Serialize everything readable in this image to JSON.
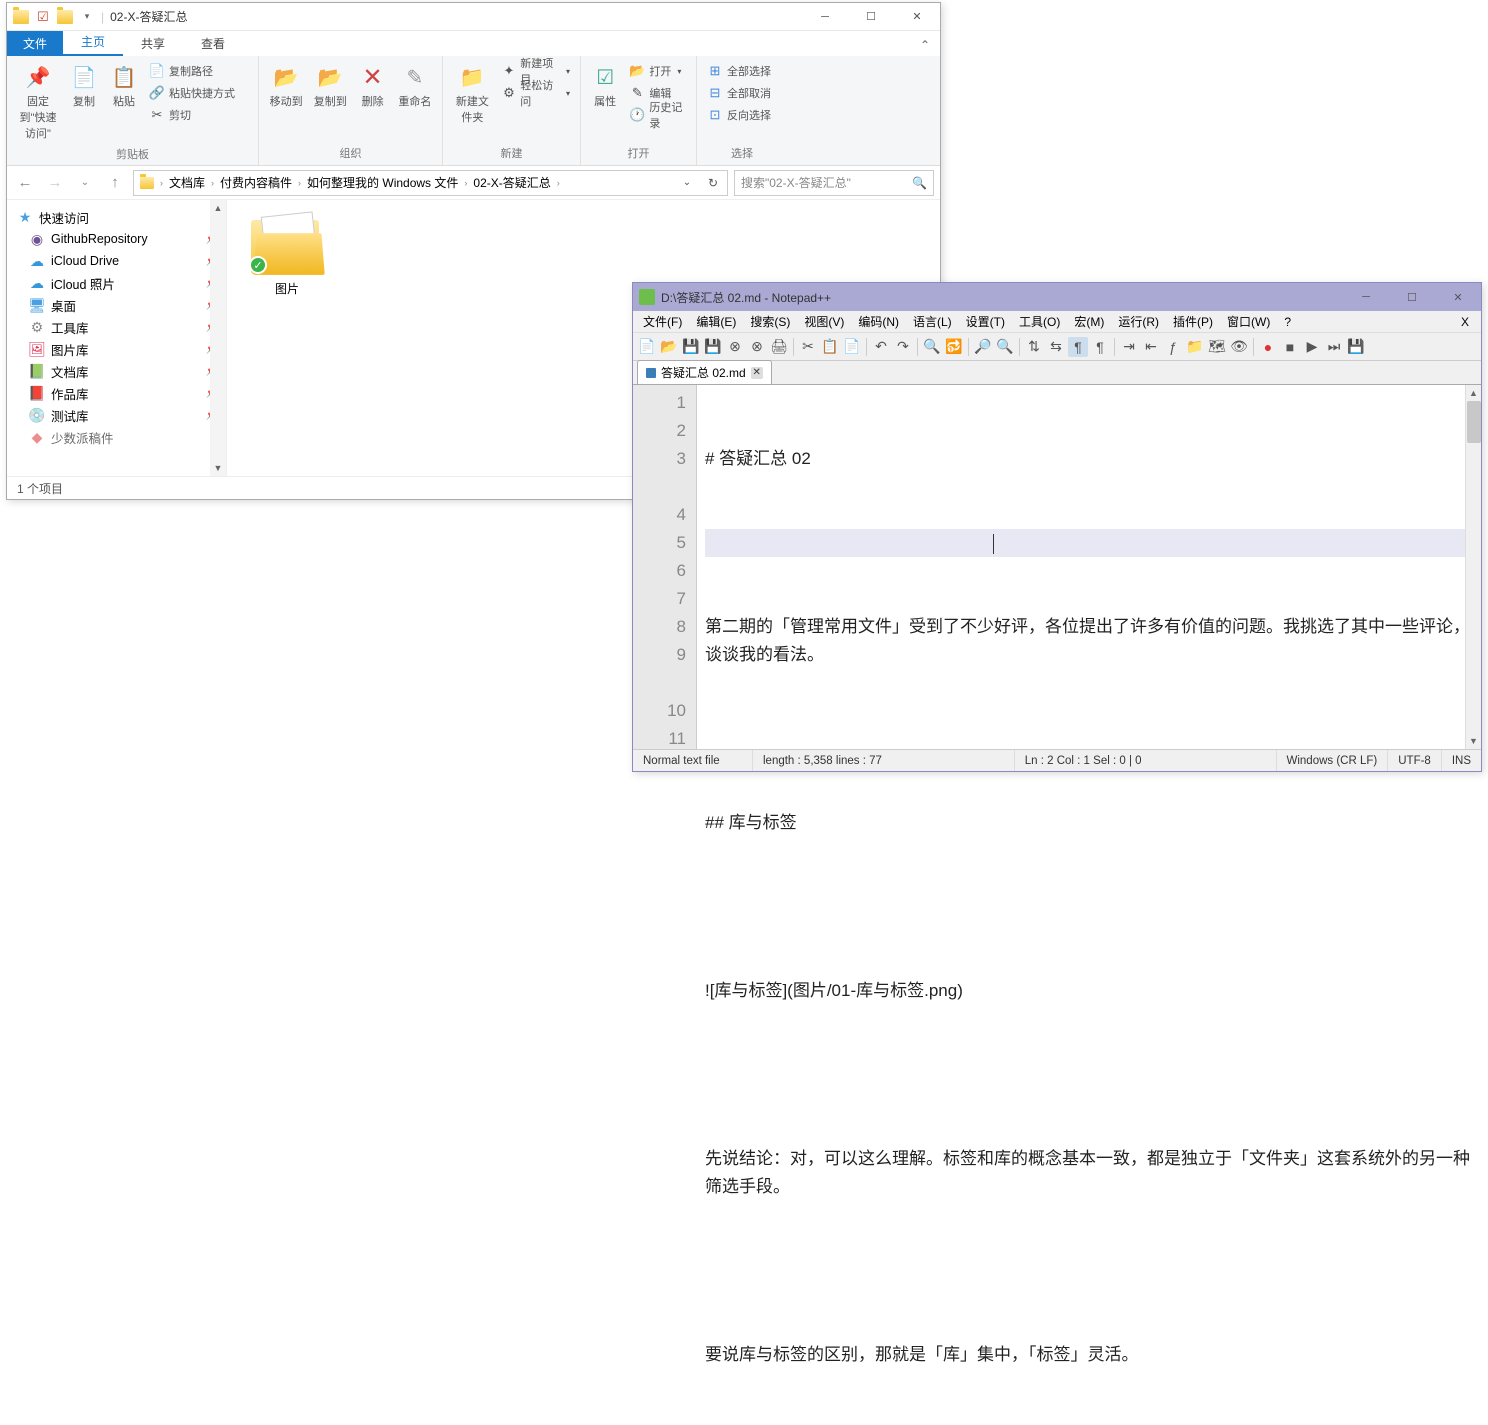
{
  "explorer": {
    "title": "02-X-答疑汇总",
    "tabs": {
      "file": "文件",
      "home": "主页",
      "share": "共享",
      "view": "查看"
    },
    "ribbon": {
      "clipboard": {
        "pin": "固定到\"快速访问\"",
        "copy": "复制",
        "paste": "粘贴",
        "copy_path": "复制路径",
        "paste_shortcut": "粘贴快捷方式",
        "cut": "剪切",
        "label": "剪贴板"
      },
      "organize": {
        "move_to": "移动到",
        "copy_to": "复制到",
        "delete": "删除",
        "rename": "重命名",
        "label": "组织"
      },
      "new": {
        "new_folder": "新建文件夹",
        "new_item": "新建项目",
        "easy_access": "轻松访问",
        "label": "新建"
      },
      "open": {
        "properties": "属性",
        "open": "打开",
        "edit": "编辑",
        "history": "历史记录",
        "label": "打开"
      },
      "select": {
        "select_all": "全部选择",
        "select_none": "全部取消",
        "invert": "反向选择",
        "label": "选择"
      }
    },
    "breadcrumbs": [
      "文档库",
      "付费内容稿件",
      "如何整理我的 Windows 文件",
      "02-X-答疑汇总"
    ],
    "search_placeholder": "搜索\"02-X-答疑汇总\"",
    "nav": {
      "quick_access": "快速访问",
      "items": [
        "GithubRepository",
        "iCloud Drive",
        "iCloud 照片",
        "桌面",
        "工具库",
        "图片库",
        "文档库",
        "作品库",
        "测试库",
        "少数派稿件"
      ]
    },
    "file_name": "图片",
    "status": "1 个项目"
  },
  "npp": {
    "title": "D:\\答疑汇总 02.md - Notepad++",
    "menu": [
      "文件(F)",
      "编辑(E)",
      "搜索(S)",
      "视图(V)",
      "编码(N)",
      "语言(L)",
      "设置(T)",
      "工具(O)",
      "宏(M)",
      "运行(R)",
      "插件(P)",
      "窗口(W)",
      "?"
    ],
    "menu_x": "X",
    "tab": "答疑汇总 02.md",
    "lines": [
      "# 答疑汇总 02",
      "",
      "第二期的「管理常用文件」受到了不少好评，各位提出了许多有价值的问题。我挑选了其中一些评论，谈谈我的看法。",
      "",
      "## 库与标签",
      "",
      "![库与标签](图片/01-库与标签.png)",
      "",
      "先说结论：对，可以这么理解。标签和库的概念基本一致，都是独立于「文件夹」这套系统外的另一种筛选手段。",
      "",
      "要说库与标签的区别，那就是「库」集中，「标签」灵活。"
    ],
    "gutter": [
      "1",
      "2",
      "3",
      "4",
      "5",
      "6",
      "7",
      "8",
      "9",
      "10",
      "11"
    ],
    "status": {
      "type": "Normal text file",
      "length": "length : 5,358    lines : 77",
      "pos": "Ln : 2    Col : 1    Sel : 0 | 0",
      "eol": "Windows (CR LF)",
      "enc": "UTF-8",
      "ins": "INS"
    }
  }
}
